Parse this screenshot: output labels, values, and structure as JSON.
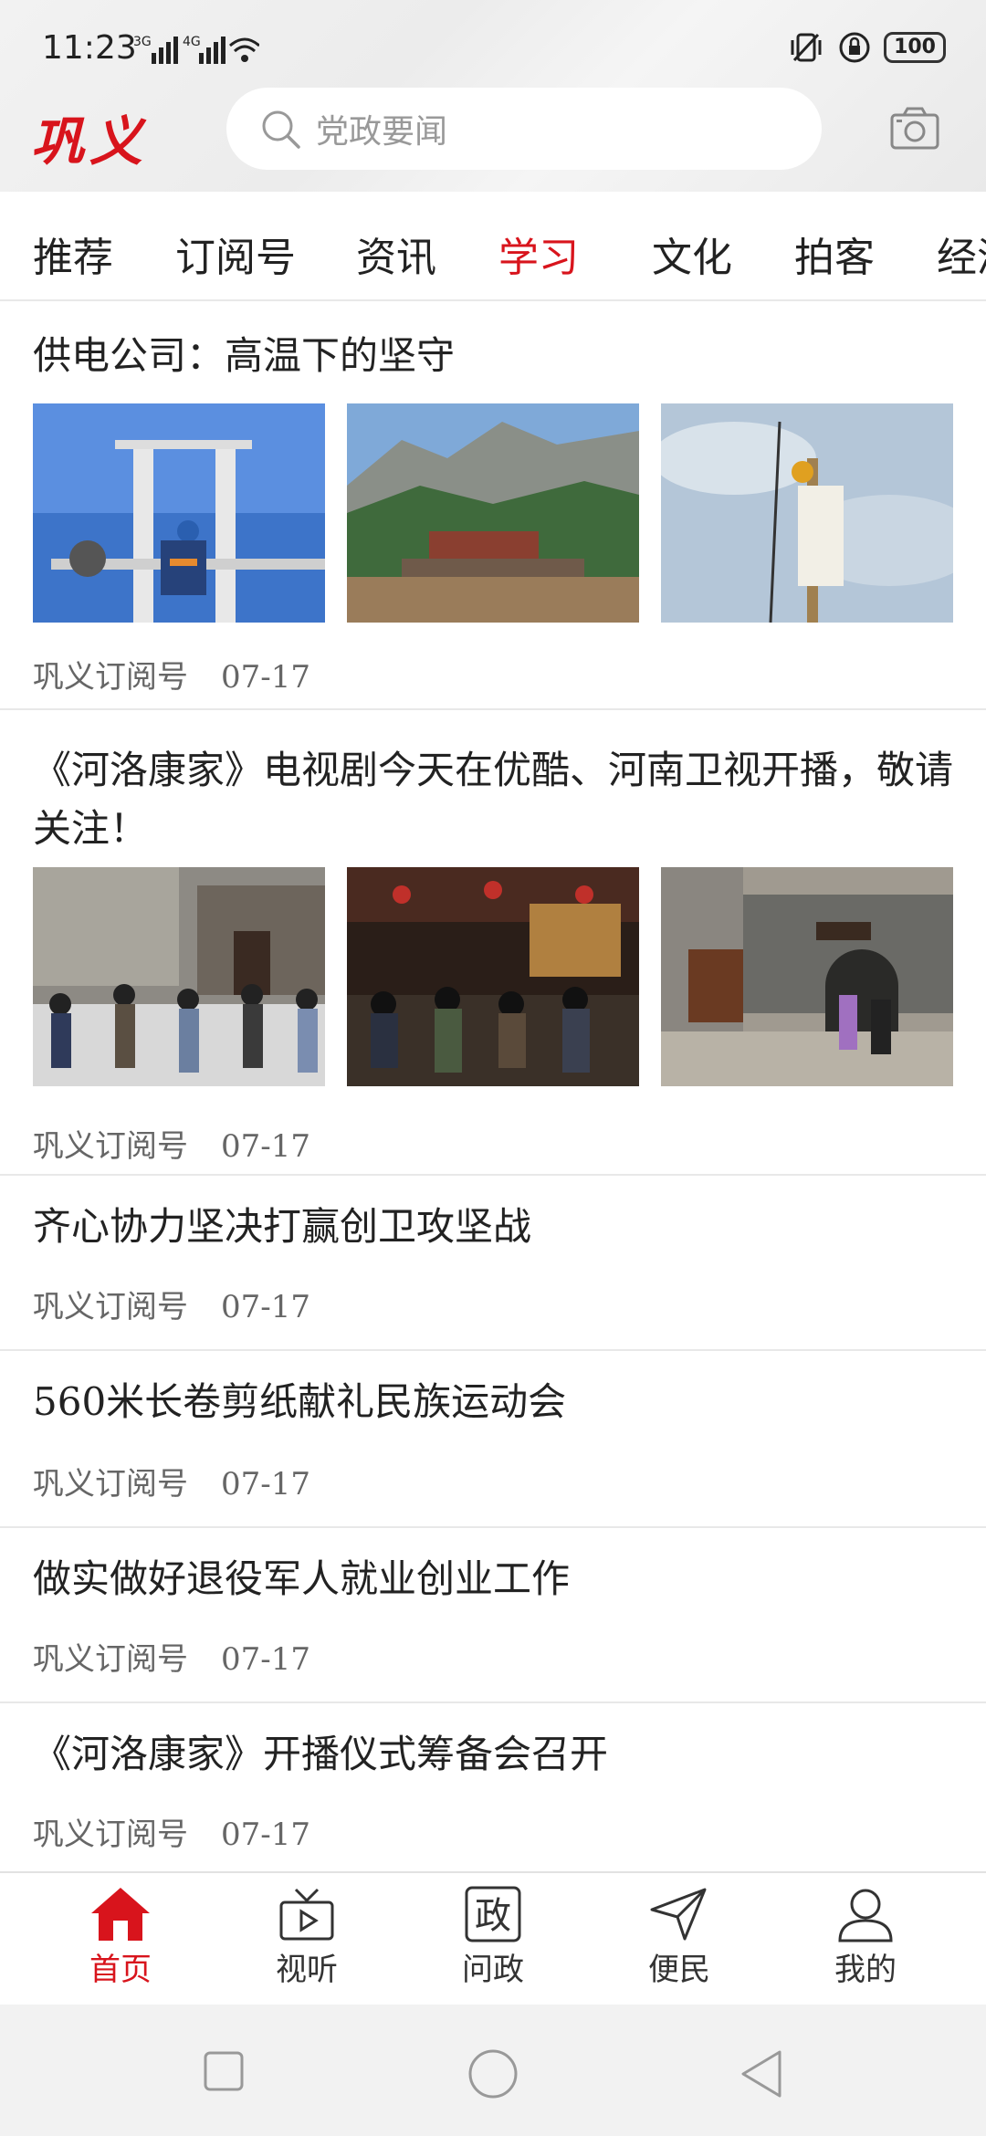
{
  "status": {
    "time": "11:23",
    "net1": "3G",
    "net2": "4G",
    "battery": "100"
  },
  "header": {
    "logo": "巩义",
    "search_placeholder": "党政要闻"
  },
  "tabs": [
    "推荐",
    "订阅号",
    "资讯",
    "学习",
    "文化",
    "拍客",
    "经济"
  ],
  "active_tab": "学习",
  "articles": [
    {
      "title": "供电公司：高温下的坚守",
      "source": "巩义订阅号",
      "date": "07-17"
    },
    {
      "title": "《河洛康家》电视剧今天在优酷、河南卫视开播，敬请关注！",
      "source": "巩义订阅号",
      "date": "07-17"
    },
    {
      "title": "齐心协力坚决打赢创卫攻坚战",
      "source": "巩义订阅号",
      "date": "07-17"
    },
    {
      "title": "560米长卷剪纸献礼民族运动会",
      "source": "巩义订阅号",
      "date": "07-17"
    },
    {
      "title": "做实做好退役军人就业创业工作",
      "source": "巩义订阅号",
      "date": "07-17"
    },
    {
      "title": "《河洛康家》开播仪式筹备会召开",
      "source": "巩义订阅号",
      "date": "07-17"
    }
  ],
  "bottom_nav": [
    {
      "label": "首页",
      "icon": "home-icon"
    },
    {
      "label": "视听",
      "icon": "tv-icon"
    },
    {
      "label": "问政",
      "icon": "zheng-icon",
      "glyph": "政"
    },
    {
      "label": "便民",
      "icon": "send-icon"
    },
    {
      "label": "我的",
      "icon": "user-icon"
    }
  ],
  "colors": {
    "accent": "#d8141c",
    "text": "#222222",
    "meta": "#666666"
  }
}
